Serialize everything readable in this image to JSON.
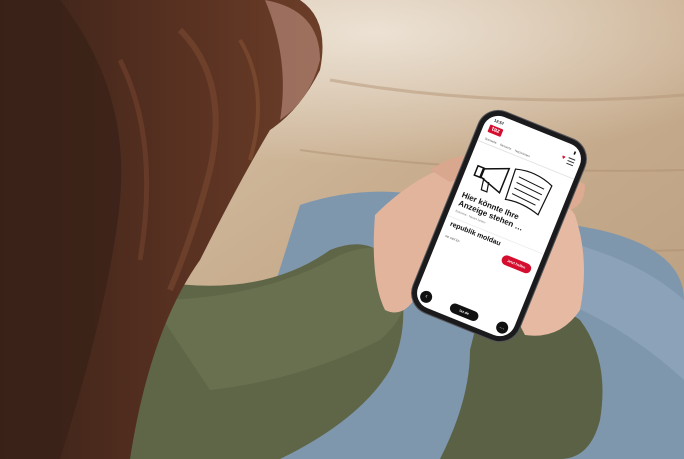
{
  "scene": {
    "photo_colors": {
      "hair": "#4a2a1c",
      "sweater": "#5f6648",
      "cushion": "#7f97ad",
      "floor": "#c6ad8f",
      "phone_frame": "#1b1b1d"
    }
  },
  "phone_screen": {
    "status_time": "12:57",
    "logo": "taz",
    "nav": [
      "Startseite",
      "Ressorts",
      "Nachrichten"
    ],
    "headline": "Hier könnte Ihre Anzeige stehen …",
    "meta": "Kolumne · Neues Lesen",
    "section": "republik moldau",
    "support_text": "taz zahl ich",
    "support_button": "Jetzt helfen",
    "pill_label": "taz.de",
    "icons": {
      "left_button": "chevron-left-icon",
      "right_button": "more-icon",
      "heart": "heart-icon",
      "menu": "menu-icon"
    }
  }
}
